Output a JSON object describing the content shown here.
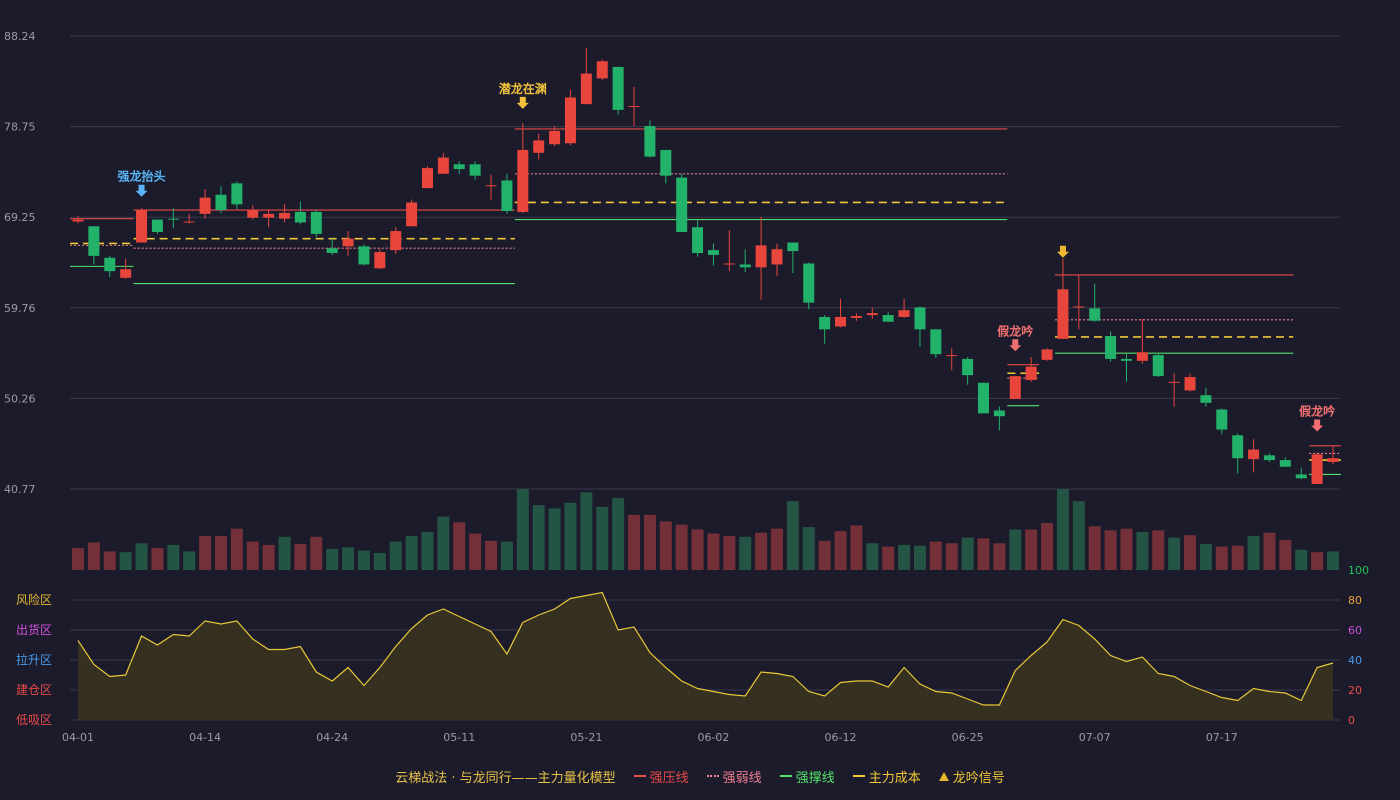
{
  "chart_data": [
    {
      "type": "candlestick",
      "panel": "price",
      "y_ticks": [
        "88.24",
        "78.75",
        "69.25",
        "59.76",
        "50.26",
        "40.77"
      ],
      "ylim": [
        40.77,
        88.24
      ],
      "colors": {
        "up": "#e8453c",
        "down": "#22b26a",
        "grid": "#3a3a4c",
        "tick": "#9a9aa8"
      },
      "candles": [
        [
          68.8,
          69.0,
          69.4,
          68.6
        ],
        [
          68.3,
          65.2,
          68.3,
          64.3
        ],
        [
          65.0,
          63.6,
          65.2,
          63.0
        ],
        [
          62.9,
          63.8,
          64.9,
          62.8
        ],
        [
          66.6,
          70.0,
          70.2,
          66.6
        ],
        [
          69.0,
          67.7,
          69.0,
          67.5
        ],
        [
          69.1,
          69.0,
          70.2,
          68.1
        ],
        [
          68.8,
          68.8,
          69.6,
          68.6
        ],
        [
          69.6,
          71.3,
          72.2,
          69.1
        ],
        [
          71.6,
          70.0,
          72.5,
          69.7
        ],
        [
          72.8,
          70.6,
          73.0,
          70.1
        ],
        [
          69.2,
          70.0,
          70.5,
          69.0
        ],
        [
          69.2,
          69.6,
          70.1,
          68.2
        ],
        [
          69.1,
          69.7,
          70.6,
          68.7
        ],
        [
          69.8,
          68.7,
          70.9,
          68.5
        ],
        [
          69.8,
          67.5,
          70.0,
          67.2
        ],
        [
          66.0,
          65.5,
          67.0,
          65.3
        ],
        [
          66.2,
          67.0,
          67.8,
          65.2
        ],
        [
          66.2,
          64.3,
          66.4,
          64.2
        ],
        [
          63.9,
          65.6,
          65.9,
          63.8
        ],
        [
          65.8,
          67.8,
          68.2,
          65.4
        ],
        [
          68.3,
          70.8,
          71.1,
          68.3
        ],
        [
          72.3,
          74.4,
          74.6,
          72.3
        ],
        [
          73.8,
          75.5,
          76.0,
          73.8
        ],
        [
          74.8,
          74.3,
          75.1,
          73.8
        ],
        [
          74.8,
          73.6,
          75.1,
          73.2
        ],
        [
          72.6,
          72.6,
          73.7,
          71.1
        ],
        [
          73.1,
          69.9,
          73.8,
          69.6
        ],
        [
          69.8,
          76.3,
          79.1,
          69.7
        ],
        [
          76.0,
          77.3,
          78.0,
          75.3
        ],
        [
          76.9,
          78.3,
          78.8,
          76.7
        ],
        [
          77.0,
          81.8,
          82.6,
          76.8
        ],
        [
          81.1,
          84.3,
          87.0,
          81.1
        ],
        [
          83.8,
          85.6,
          85.8,
          83.6
        ],
        [
          85.0,
          80.5,
          85.0,
          80.0
        ],
        [
          80.9,
          80.9,
          82.9,
          78.8
        ],
        [
          78.8,
          75.6,
          79.4,
          75.5
        ],
        [
          76.3,
          73.6,
          76.3,
          72.8
        ],
        [
          73.4,
          67.7,
          73.8,
          67.7
        ],
        [
          68.2,
          65.5,
          68.9,
          65.1
        ],
        [
          65.8,
          65.3,
          66.5,
          64.2
        ],
        [
          64.4,
          64.4,
          67.9,
          63.6
        ],
        [
          64.3,
          64.0,
          65.9,
          63.5
        ],
        [
          64.0,
          66.3,
          69.3,
          60.6
        ],
        [
          64.3,
          65.9,
          66.5,
          63.1
        ],
        [
          66.6,
          65.7,
          66.6,
          63.4
        ],
        [
          64.4,
          60.3,
          64.5,
          59.6
        ],
        [
          58.8,
          57.5,
          59.0,
          56.0
        ],
        [
          57.8,
          58.8,
          60.7,
          57.7
        ],
        [
          58.7,
          58.9,
          59.2,
          58.4
        ],
        [
          59.0,
          59.2,
          59.8,
          58.6
        ],
        [
          59.0,
          58.3,
          59.3,
          58.3
        ],
        [
          58.8,
          59.5,
          60.7,
          58.7
        ],
        [
          59.8,
          57.5,
          59.9,
          55.7
        ],
        [
          57.5,
          54.9,
          57.5,
          54.5
        ],
        [
          54.8,
          54.8,
          55.5,
          53.2
        ],
        [
          54.4,
          52.7,
          54.6,
          51.7
        ],
        [
          51.9,
          48.7,
          51.9,
          48.7
        ],
        [
          49.0,
          48.4,
          49.4,
          46.9
        ],
        [
          50.2,
          52.6,
          52.6,
          50.2
        ],
        [
          52.2,
          53.6,
          54.6,
          52.0
        ],
        [
          54.3,
          55.4,
          55.5,
          54.2
        ],
        [
          56.5,
          61.7,
          64.9,
          56.5
        ],
        [
          59.9,
          59.9,
          63.2,
          57.5
        ],
        [
          59.7,
          58.4,
          62.3,
          58.3
        ],
        [
          56.8,
          54.4,
          57.3,
          54.1
        ],
        [
          54.4,
          54.2,
          54.9,
          52.0
        ],
        [
          54.2,
          55.1,
          58.6,
          53.9
        ],
        [
          54.8,
          52.6,
          55.0,
          52.5
        ],
        [
          52.0,
          52.0,
          52.9,
          49.4
        ],
        [
          51.1,
          52.5,
          52.9,
          51.0
        ],
        [
          50.6,
          49.8,
          51.4,
          49.4
        ],
        [
          49.1,
          47.0,
          49.2,
          46.5
        ],
        [
          46.4,
          44.0,
          46.6,
          42.4
        ],
        [
          43.9,
          44.9,
          46.0,
          42.5
        ],
        [
          44.3,
          43.8,
          44.5,
          43.6
        ],
        [
          43.8,
          43.1,
          44.1,
          43.1
        ],
        [
          42.3,
          41.9,
          43.0,
          41.8
        ],
        [
          41.3,
          44.4,
          44.6,
          41.3
        ],
        [
          43.6,
          44.0,
          45.3,
          43.4
        ]
      ],
      "lines": [
        {
          "key": "yl",
          "dash": "",
          "from": 0,
          "to": 3,
          "y": 69.1
        },
        {
          "key": "ruo",
          "dash": "dot",
          "from": 0,
          "to": 3,
          "y": 66.3
        },
        {
          "key": "cb",
          "dash": "dash",
          "from": 0,
          "to": 3,
          "y": 66.5
        },
        {
          "key": "zc",
          "dash": "",
          "from": 0,
          "to": 3,
          "y": 64.1
        },
        {
          "key": "yl",
          "dash": "",
          "from": 4,
          "to": 27,
          "y": 70.0
        },
        {
          "key": "ruo",
          "dash": "dot",
          "from": 4,
          "to": 27,
          "y": 66.0
        },
        {
          "key": "cb",
          "dash": "dash",
          "from": 4,
          "to": 27,
          "y": 67.0
        },
        {
          "key": "zc",
          "dash": "",
          "from": 4,
          "to": 27,
          "y": 62.3
        },
        {
          "key": "yl",
          "dash": "",
          "from": 28,
          "to": 58,
          "y": 78.5
        },
        {
          "key": "ruo",
          "dash": "dot",
          "from": 28,
          "to": 58,
          "y": 73.8
        },
        {
          "key": "cb",
          "dash": "dash",
          "from": 28,
          "to": 58,
          "y": 70.8
        },
        {
          "key": "zc",
          "dash": "",
          "from": 28,
          "to": 58,
          "y": 69.0
        },
        {
          "key": "yl",
          "dash": "",
          "from": 59,
          "to": 60,
          "y": 53.8
        },
        {
          "key": "ruo",
          "dash": "dot",
          "from": 59,
          "to": 60,
          "y": 52.4
        },
        {
          "key": "cb",
          "dash": "dash",
          "from": 59,
          "to": 60,
          "y": 52.9
        },
        {
          "key": "zc",
          "dash": "",
          "from": 59,
          "to": 60,
          "y": 49.5
        },
        {
          "key": "yl",
          "dash": "",
          "from": 62,
          "to": 76,
          "y": 63.2
        },
        {
          "key": "ruo",
          "dash": "dot",
          "from": 62,
          "to": 76,
          "y": 58.5
        },
        {
          "key": "cb",
          "dash": "dash",
          "from": 62,
          "to": 76,
          "y": 56.7
        },
        {
          "key": "zc",
          "dash": "",
          "from": 62,
          "to": 76,
          "y": 55.0
        },
        {
          "key": "yl",
          "dash": "",
          "from": 78,
          "to": 79,
          "y": 45.3
        },
        {
          "key": "ruo",
          "dash": "dot",
          "from": 78,
          "to": 79,
          "y": 44.5
        },
        {
          "key": "cb",
          "dash": "dash",
          "from": 78,
          "to": 79,
          "y": 43.8
        },
        {
          "key": "zc",
          "dash": "",
          "from": 78,
          "to": 79,
          "y": 42.3
        }
      ],
      "signals": [
        {
          "i": 4,
          "label": "强龙抬头",
          "color": "#59b3f5",
          "y": 71.4
        },
        {
          "i": 28,
          "label": "潜龙在渊",
          "color": "#f0c23c",
          "y": 80.6
        },
        {
          "i": 62,
          "label": "",
          "color": "#f0b830",
          "y": 65.0
        },
        {
          "i": 59,
          "label": "假龙吟",
          "color": "#f07070",
          "y": 55.2
        },
        {
          "i": 78,
          "label": "假龙吟",
          "color": "#f07070",
          "y": 46.8
        }
      ]
    },
    {
      "type": "bar",
      "panel": "volume",
      "values": [
        27,
        34,
        23,
        22,
        33,
        27,
        31,
        23,
        42,
        42,
        51,
        35,
        31,
        41,
        32,
        41,
        26,
        28,
        24,
        21,
        35,
        42,
        47,
        66,
        59,
        45,
        36,
        35,
        100,
        80,
        76,
        83,
        96,
        78,
        89,
        68,
        68,
        60,
        56,
        50,
        45,
        42,
        41,
        46,
        51,
        85,
        53,
        36,
        48,
        55,
        33,
        29,
        31,
        30,
        35,
        33,
        40,
        39,
        33,
        50,
        50,
        58,
        100,
        85,
        54,
        49,
        51,
        47,
        49,
        40,
        43,
        32,
        29,
        30,
        42,
        46,
        37,
        25,
        22,
        23,
        31,
        29
      ],
      "up": [
        1,
        1,
        1,
        0,
        0,
        1,
        0,
        0,
        1,
        1,
        1,
        1,
        1,
        0,
        1,
        1,
        0,
        0,
        0,
        0,
        0,
        0,
        0,
        0,
        1,
        1,
        1,
        0,
        0,
        0,
        0,
        0,
        0,
        0,
        0,
        1,
        1,
        1,
        1,
        1,
        1,
        1,
        0,
        1,
        1,
        0,
        0,
        1,
        1,
        1,
        0,
        1,
        0,
        0,
        1,
        1,
        0,
        1,
        1,
        0,
        1,
        1,
        0,
        0,
        1,
        1,
        1,
        0,
        1,
        0,
        1,
        0,
        1,
        1,
        0,
        1,
        1,
        0,
        1,
        0,
        0,
        0
      ],
      "colors": {
        "up": "#743038",
        "down": "#235444"
      }
    },
    {
      "type": "area",
      "panel": "indicator",
      "y_ticks": [
        "100",
        "80",
        "60",
        "40",
        "20",
        "0"
      ],
      "y_tick_colors": [
        "#22c25a",
        "#e8a13a",
        "#c850d0",
        "#4a9ae8",
        "#e84a4a",
        "#e84a4a"
      ],
      "zones": [
        {
          "label": "风险区",
          "color": "#e8b830"
        },
        {
          "label": "出货区",
          "color": "#d050d8"
        },
        {
          "label": "拉升区",
          "color": "#4a9ae8"
        },
        {
          "label": "建仓区",
          "color": "#e84a4a"
        },
        {
          "label": "低吸区",
          "color": "#e84a4a"
        }
      ],
      "ylim": [
        0,
        100
      ],
      "values": [
        53,
        37,
        29,
        30,
        56,
        50,
        57,
        56,
        66,
        64,
        66,
        54,
        47,
        47,
        49,
        32,
        26,
        35,
        23,
        35,
        49,
        61,
        70,
        74,
        69,
        64,
        59,
        44,
        65,
        70,
        74,
        81,
        83,
        85,
        60,
        62,
        45,
        35,
        26,
        21,
        19,
        17,
        16,
        32,
        31,
        29,
        19,
        16,
        25,
        26,
        26,
        22,
        35,
        24,
        19,
        18,
        14,
        10,
        10,
        33,
        43,
        52,
        67,
        63,
        54,
        43,
        39,
        42,
        31,
        29,
        23,
        19,
        15,
        13,
        21,
        19,
        18,
        13,
        35,
        38
      ],
      "line_color": "#e8c838",
      "fill_color": "#35301f"
    }
  ],
  "x_ticks": [
    {
      "label": "04-01",
      "i": 0
    },
    {
      "label": "04-14",
      "i": 8
    },
    {
      "label": "04-24",
      "i": 16
    },
    {
      "label": "05-11",
      "i": 24
    },
    {
      "label": "05-21",
      "i": 32
    },
    {
      "label": "06-02",
      "i": 40
    },
    {
      "label": "06-12",
      "i": 48
    },
    {
      "label": "06-25",
      "i": 56
    },
    {
      "label": "07-07",
      "i": 64
    },
    {
      "label": "07-17",
      "i": 72
    }
  ],
  "legend": {
    "title": "云梯战法 · 与龙同行——主力量化模型",
    "items": [
      {
        "label": "强压线",
        "color": "#e84a4a",
        "style": "solid"
      },
      {
        "label": "强弱线",
        "color": "#f08090",
        "style": "dot"
      },
      {
        "label": "强撑线",
        "color": "#55e06a",
        "style": "solid"
      },
      {
        "label": "主力成本",
        "color": "#f0c838",
        "style": "dash"
      },
      {
        "label": "龙吟信号",
        "color": "#e8b830",
        "style": "triangle"
      }
    ]
  }
}
